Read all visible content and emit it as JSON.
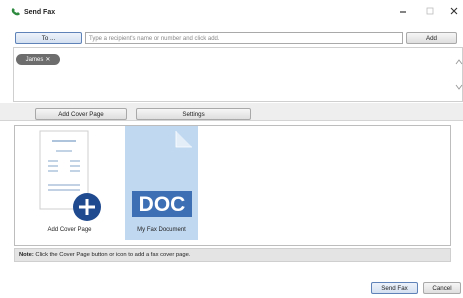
{
  "window": {
    "title": "Send Fax",
    "minimize": "–",
    "maximize": "□",
    "close": "✕"
  },
  "recipients": {
    "to_label": "To ...",
    "placeholder": "Type a recipient's name or number and click add.",
    "add_label": "Add",
    "chip_name": "James",
    "chip_remove": "✕"
  },
  "toolbar": {
    "cover_label": "Add Cover Page",
    "settings_label": "Settings"
  },
  "documents": [
    {
      "label": "Add Cover Page",
      "icon": "cover-page-add-icon"
    },
    {
      "label": "My Fax Document",
      "icon": "doc-file-icon",
      "file_type": "DOC",
      "selected": true
    }
  ],
  "note": {
    "bold": "Note:",
    "text": " Click the Cover Page button or icon to add a fax cover page."
  },
  "footer": {
    "send_label": "Send Fax",
    "cancel_label": "Cancel"
  },
  "colors": {
    "selection": "#c0d8f0",
    "doc_blue": "#3d6fb5",
    "chip": "#6d6d6d"
  }
}
